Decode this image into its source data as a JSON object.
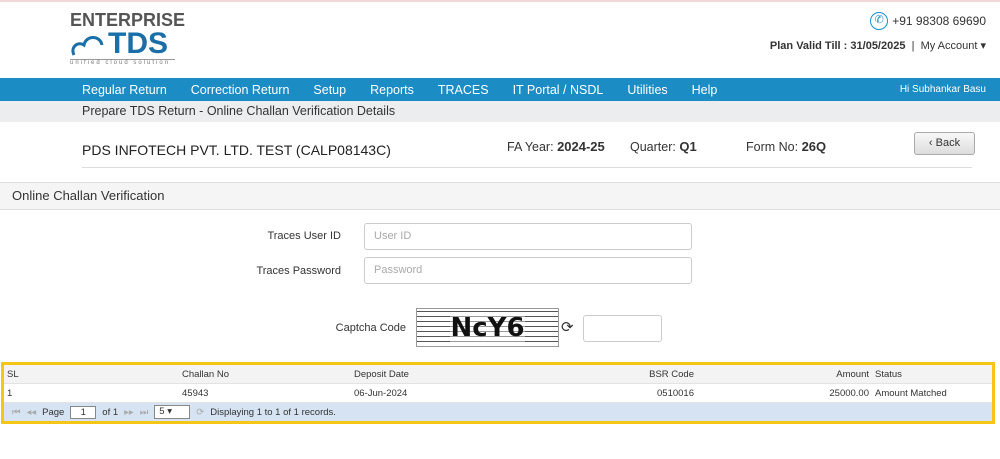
{
  "logo": {
    "line1": "ENTERPRISE",
    "line2": "TDS",
    "tagline": "unified cloud solution"
  },
  "header": {
    "phone": "+91 98308 69690",
    "plan_label": "Plan Valid Till : ",
    "plan_date": "31/05/2025",
    "account": "My Account ▾"
  },
  "nav": {
    "items": [
      "Regular Return",
      "Correction Return",
      "Setup",
      "Reports",
      "TRACES",
      "IT Portal / NSDL",
      "Utilities",
      "Help"
    ],
    "greeting": "Hi Subhankar Basu"
  },
  "breadcrumb": "Prepare TDS Return - Online Challan Verification Details",
  "info": {
    "company": "PDS INFOTECH PVT. LTD. TEST (CALP08143C)",
    "fy_label": "FA Year:",
    "fy": "2024-25",
    "q_label": "Quarter:",
    "q": "Q1",
    "form_label": "Form No:",
    "form": "26Q",
    "back": "Back"
  },
  "panel_title": "Online Challan Verification",
  "form": {
    "user_label": "Traces User ID",
    "user_ph": "User ID",
    "pass_label": "Traces Password",
    "pass_ph": "Password",
    "captcha_label": "Captcha Code",
    "captcha_text": "NcY6"
  },
  "table": {
    "headers": [
      "SL",
      "Challan No",
      "Deposit Date",
      "BSR Code",
      "Amount",
      "Status"
    ],
    "rows": [
      [
        "1",
        "45943",
        "06-Jun-2024",
        "0510016",
        "25000.00",
        "Amount Matched"
      ]
    ]
  },
  "pager": {
    "page_label": "Page",
    "page": "1",
    "of": "of 1",
    "size": "5",
    "display": "Displaying 1 to 1 of 1 records."
  }
}
